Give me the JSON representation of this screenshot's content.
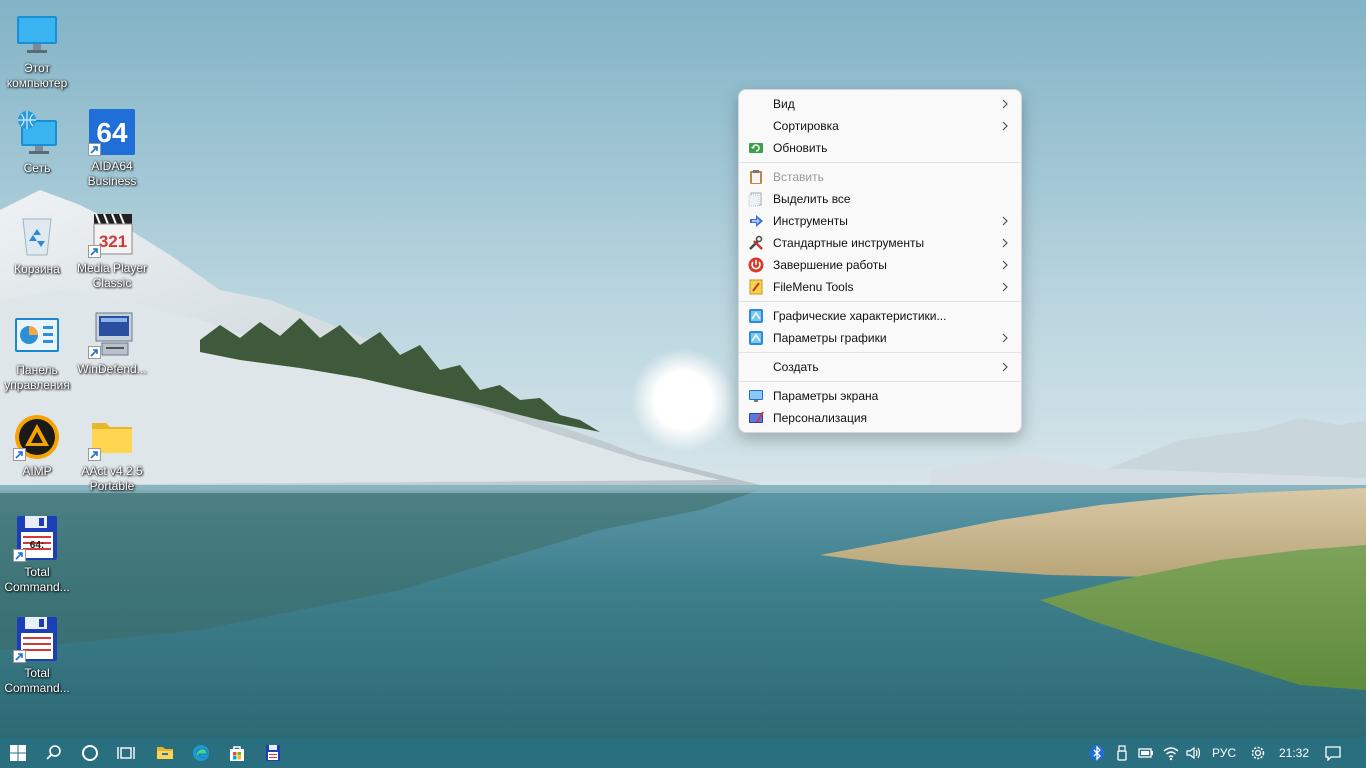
{
  "desktop": {
    "icons": [
      {
        "label": "Этот\nкомпьютер",
        "icon": "monitor-icon"
      },
      {
        "label": "Сеть",
        "icon": "network-icon"
      },
      {
        "label": "AIDA64\nBusiness",
        "icon": "aida64-icon"
      },
      {
        "label": "Корзина",
        "icon": "recycle-bin-icon"
      },
      {
        "label": "Media Player\nClassic",
        "icon": "media-player-classic-icon"
      },
      {
        "label": "Панель\nуправления",
        "icon": "control-panel-icon"
      },
      {
        "label": "WinDefend...",
        "icon": "windefender-icon"
      },
      {
        "label": "AIMP",
        "icon": "aimp-icon"
      },
      {
        "label": "AAct v4.2.5\nPortable",
        "icon": "folder-icon"
      },
      {
        "label": "Total\nCommand...",
        "icon": "total-commander-64-icon"
      },
      {
        "label": "Total\nCommand...",
        "icon": "total-commander-icon"
      }
    ],
    "aida_text": "64",
    "mpc_text": "321",
    "tc64_text": "64:"
  },
  "context_menu": {
    "items": [
      {
        "label": "Вид",
        "submenu": true
      },
      {
        "label": "Сортировка",
        "submenu": true
      },
      {
        "label": "Обновить",
        "icon": "refresh-icon"
      },
      {
        "label": "Вставить",
        "icon": "clipboard-icon",
        "disabled": true
      },
      {
        "label": "Выделить все",
        "icon": "select-all-icon"
      },
      {
        "label": "Инструменты",
        "icon": "tools-arrow-icon",
        "submenu": true
      },
      {
        "label": "Стандартные инструменты",
        "icon": "wrench-icon",
        "submenu": true
      },
      {
        "label": "Завершение работы",
        "icon": "power-icon",
        "submenu": true
      },
      {
        "label": "FileMenu Tools",
        "icon": "filemenu-tools-icon",
        "submenu": true
      },
      {
        "label": "Графические характеристики...",
        "icon": "intel-graphics-icon"
      },
      {
        "label": "Параметры графики",
        "icon": "intel-graphics-icon",
        "submenu": true
      },
      {
        "label": "Создать",
        "submenu": true
      },
      {
        "label": "Параметры экрана",
        "icon": "display-icon"
      },
      {
        "label": "Персонализация",
        "icon": "personalize-icon"
      }
    ]
  },
  "taskbar": {
    "buttons": [
      "start-icon",
      "search-icon",
      "cortana-icon",
      "task-view-icon",
      "file-explorer-icon",
      "edge-icon",
      "store-icon",
      "total-commander-icon"
    ],
    "tray": {
      "icons": [
        "bluetooth-icon",
        "usb-icon",
        "battery-icon",
        "wifi-icon",
        "volume-icon"
      ],
      "language": "РУС",
      "time": "21:32"
    }
  },
  "colors": {
    "taskbar": "#2a6f80",
    "menu_bg": "#f9f9f9",
    "accent_blue": "#1f6fd6"
  }
}
